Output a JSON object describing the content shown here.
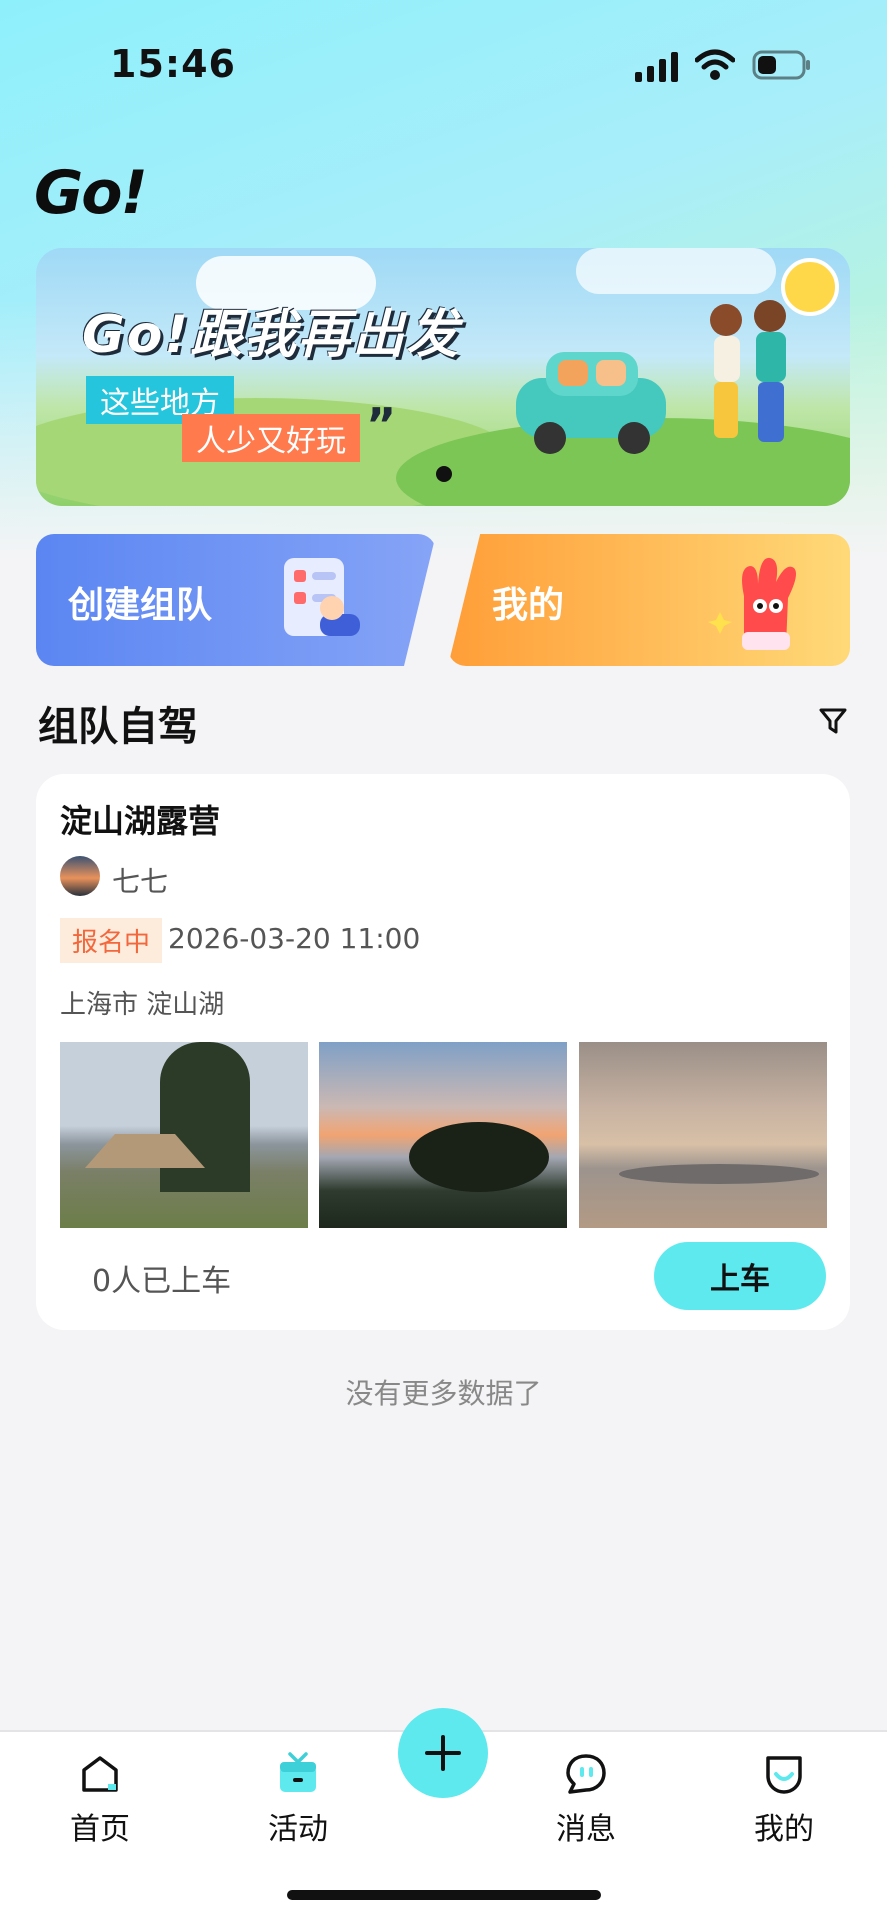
{
  "status_bar": {
    "time": "15:46"
  },
  "app": {
    "logo": "Go!"
  },
  "banner": {
    "title": "Go!跟我再出发",
    "tag1": "这些地方",
    "tag2": "人少又好玩",
    "quote": "”"
  },
  "quick_cards": {
    "create_label": "创建组队",
    "mine_label": "我的"
  },
  "section": {
    "title": "组队自驾"
  },
  "trip": {
    "title": "淀山湖露营",
    "author": "七七",
    "status": "报名中",
    "datetime": "2026-03-20 11:00",
    "location": "上海市 淀山湖",
    "passengers": "0人已上车",
    "join_label": "上车"
  },
  "list": {
    "end_text": "没有更多数据了"
  },
  "tabbar": {
    "items": [
      {
        "label": "首页",
        "icon": "home-icon"
      },
      {
        "label": "活动",
        "icon": "activity-icon"
      },
      {
        "label": "消息",
        "icon": "message-icon"
      },
      {
        "label": "我的",
        "icon": "profile-icon"
      }
    ],
    "plus_icon": "plus-icon"
  },
  "colors": {
    "accent": "#5ee9ee",
    "create_card": "#5b86f2",
    "mine_card": "#ff9e38",
    "status_badge": "#f2683c"
  }
}
